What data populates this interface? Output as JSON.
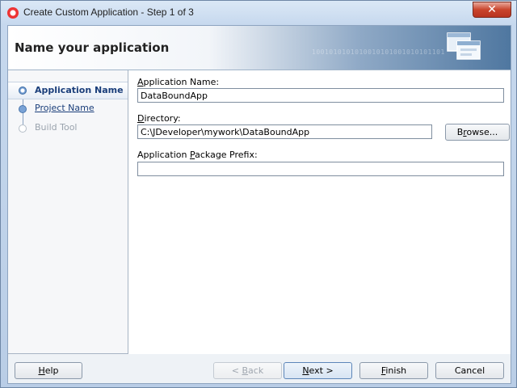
{
  "window": {
    "title": "Create Custom Application - Step 1 of 3",
    "close_glyph": "✕"
  },
  "header": {
    "title": "Name your application",
    "binary_decor": "1001010101010010101001010101101"
  },
  "steps": [
    {
      "label": "Application Name",
      "state": "active"
    },
    {
      "label": "Project Name",
      "state": "link"
    },
    {
      "label": "Build Tool",
      "state": "disabled"
    }
  ],
  "form": {
    "app_name": {
      "label_prefix": "",
      "mnemonic": "A",
      "label_rest": "pplication Name:",
      "value": "DataBoundApp"
    },
    "directory": {
      "mnemonic": "D",
      "label_rest": "irectory:",
      "value": "C:\\JDeveloper\\mywork\\DataBoundApp",
      "browse_label": "Browse...",
      "browse_mnemonic": "r"
    },
    "package_prefix": {
      "label_before": "Application ",
      "mnemonic": "P",
      "label_rest": "ackage Prefix:",
      "value": ""
    }
  },
  "buttons": {
    "help": {
      "mnemonic": "H",
      "rest": "elp"
    },
    "back": {
      "before": "< ",
      "mnemonic": "B",
      "rest": "ack"
    },
    "next": {
      "mnemonic": "N",
      "rest": "ext >"
    },
    "finish": {
      "mnemonic": "F",
      "rest": "inish"
    },
    "cancel": {
      "label": "Cancel"
    }
  },
  "colors": {
    "accent": "#1a3e7a",
    "close": "#c9442c"
  }
}
